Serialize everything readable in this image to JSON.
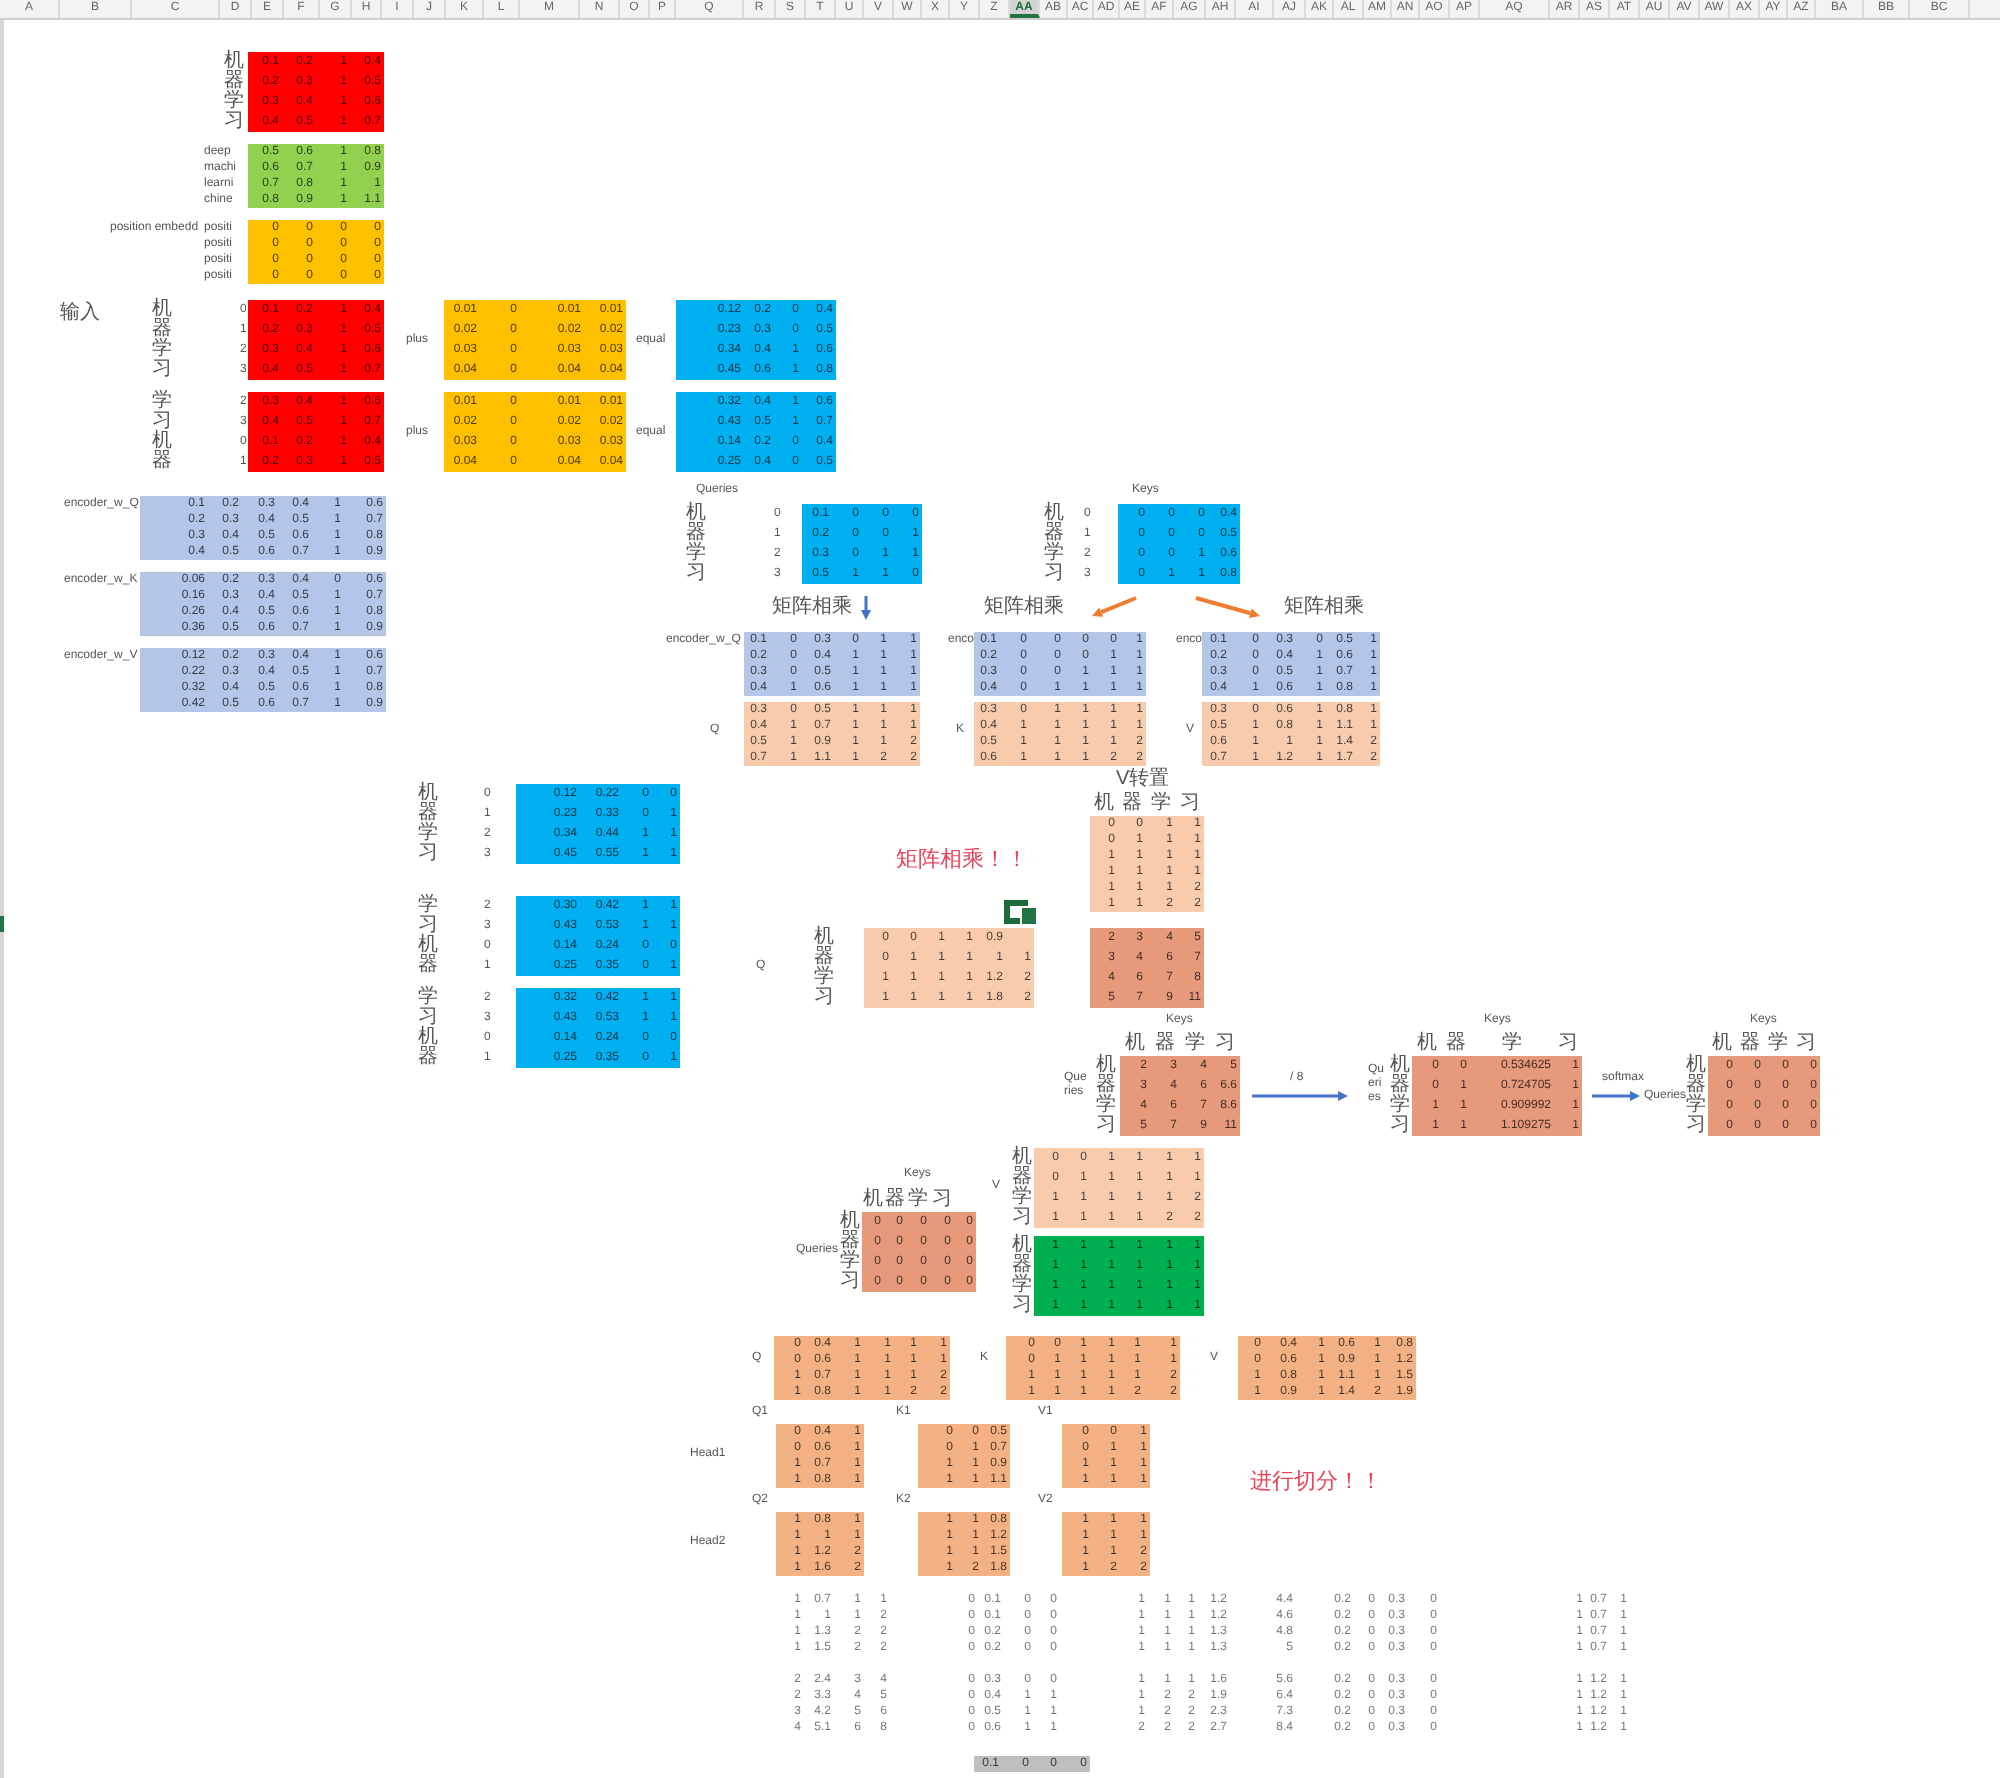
{
  "column_headers": [
    {
      "label": "A",
      "selected": false
    },
    {
      "label": "B",
      "selected": false
    },
    {
      "label": "C",
      "selected": false
    },
    {
      "label": "D",
      "selected": false
    },
    {
      "label": "E",
      "selected": false
    },
    {
      "label": "F",
      "selected": false
    },
    {
      "label": "G",
      "selected": false
    },
    {
      "label": "H",
      "selected": false
    },
    {
      "label": "I",
      "selected": false
    },
    {
      "label": "J",
      "selected": false
    },
    {
      "label": "K",
      "selected": false
    },
    {
      "label": "L",
      "selected": false
    },
    {
      "label": "M",
      "selected": false
    },
    {
      "label": "N",
      "selected": false
    },
    {
      "label": "O",
      "selected": false
    },
    {
      "label": "P",
      "selected": false
    },
    {
      "label": "Q",
      "selected": false
    },
    {
      "label": "R",
      "selected": false
    },
    {
      "label": "S",
      "selected": false
    },
    {
      "label": "T",
      "selected": false
    },
    {
      "label": "U",
      "selected": false
    },
    {
      "label": "V",
      "selected": false
    },
    {
      "label": "W",
      "selected": false
    },
    {
      "label": "X",
      "selected": false
    },
    {
      "label": "Y",
      "selected": false
    },
    {
      "label": "Z",
      "selected": false
    },
    {
      "label": "AA",
      "selected": true
    },
    {
      "label": "AB",
      "selected": false
    },
    {
      "label": "AC",
      "selected": false
    },
    {
      "label": "AD",
      "selected": false
    },
    {
      "label": "AE",
      "selected": false
    },
    {
      "label": "AF",
      "selected": false
    },
    {
      "label": "AG",
      "selected": false
    },
    {
      "label": "AH",
      "selected": false
    },
    {
      "label": "AI",
      "selected": false
    },
    {
      "label": "AJ",
      "selected": false
    },
    {
      "label": "AK",
      "selected": false
    },
    {
      "label": "AL",
      "selected": false
    },
    {
      "label": "AM",
      "selected": false
    },
    {
      "label": "AN",
      "selected": false
    },
    {
      "label": "AO",
      "selected": false
    },
    {
      "label": "AP",
      "selected": false
    },
    {
      "label": "AQ",
      "selected": false
    },
    {
      "label": "AR",
      "selected": false
    },
    {
      "label": "AS",
      "selected": false
    },
    {
      "label": "AT",
      "selected": false
    },
    {
      "label": "AU",
      "selected": false
    },
    {
      "label": "AV",
      "selected": false
    },
    {
      "label": "AW",
      "selected": false
    },
    {
      "label": "AX",
      "selected": false
    },
    {
      "label": "AY",
      "selected": false
    },
    {
      "label": "AZ",
      "selected": false
    },
    {
      "label": "BA",
      "selected": false
    },
    {
      "label": "BB",
      "selected": false
    },
    {
      "label": "BC",
      "selected": false
    }
  ],
  "matrices": [
    {
      "row_labels": [
        "机",
        "器",
        "学",
        "习"
      ],
      "color": "#ff0000",
      "rows": [
        [
          "0.1",
          "0.2",
          "1",
          "0.4"
        ],
        [
          "0.2",
          "0.3",
          "1",
          "0.5"
        ],
        [
          "0.3",
          "0.4",
          "1",
          "0.6"
        ],
        [
          "0.4",
          "0.5",
          "1",
          "0.7"
        ]
      ]
    },
    {
      "row_labels": [
        "deep",
        "machi",
        "learni",
        "chine"
      ],
      "color": "#92d050",
      "rows": [
        [
          "0.5",
          "0.6",
          "1",
          "0.8"
        ],
        [
          "0.6",
          "0.7",
          "1",
          "0.9"
        ],
        [
          "0.7",
          "0.8",
          "1",
          "1"
        ],
        [
          "0.8",
          "0.9",
          "1",
          "1.1"
        ]
      ]
    },
    {
      "row_labels": [
        "positi",
        "positi",
        "positi",
        "positi"
      ],
      "color": "#ffc000",
      "rows": [
        [
          "0",
          "0",
          "0",
          "0"
        ],
        [
          "0",
          "0",
          "0",
          "0"
        ],
        [
          "0",
          "0",
          "0",
          "0"
        ],
        [
          "0",
          "0",
          "0",
          "0"
        ]
      ]
    },
    {
      "row_labels": [
        "机",
        "器",
        "学",
        "习"
      ],
      "row_index": [
        "0",
        "1",
        "2",
        "3"
      ],
      "color": "#ff0000",
      "rows": [
        [
          "0.1",
          "0.2",
          "1",
          "0.4"
        ],
        [
          "0.2",
          "0.3",
          "1",
          "0.5"
        ],
        [
          "0.3",
          "0.4",
          "1",
          "0.6"
        ],
        [
          "0.4",
          "0.5",
          "1",
          "0.7"
        ]
      ]
    },
    {
      "color": "#ffc000",
      "rows": [
        [
          "0.01",
          "0",
          "0.01",
          "0.01"
        ],
        [
          "0.02",
          "0",
          "0.02",
          "0.02"
        ],
        [
          "0.03",
          "0",
          "0.03",
          "0.03"
        ],
        [
          "0.04",
          "0",
          "0.04",
          "0.04"
        ]
      ]
    },
    {
      "color": "#00b0f0",
      "rows": [
        [
          "0.12",
          "0.2",
          "0",
          "0.4"
        ],
        [
          "0.23",
          "0.3",
          "0",
          "0.5"
        ],
        [
          "0.34",
          "0.4",
          "1",
          "0.6"
        ],
        [
          "0.45",
          "0.6",
          "1",
          "0.8"
        ]
      ]
    },
    {
      "row_labels": [
        "学",
        "习",
        "机",
        "器"
      ],
      "row_index": [
        "2",
        "3",
        "0",
        "1"
      ],
      "color": "#ff0000",
      "rows": [
        [
          "0.3",
          "0.4",
          "1",
          "0.6"
        ],
        [
          "0.4",
          "0.5",
          "1",
          "0.7"
        ],
        [
          "0.1",
          "0.2",
          "1",
          "0.4"
        ],
        [
          "0.2",
          "0.3",
          "1",
          "0.5"
        ]
      ]
    },
    {
      "color": "#ffc000",
      "rows": [
        [
          "0.01",
          "0",
          "0.01",
          "0.01"
        ],
        [
          "0.02",
          "0",
          "0.02",
          "0.02"
        ],
        [
          "0.03",
          "0",
          "0.03",
          "0.03"
        ],
        [
          "0.04",
          "0",
          "0.04",
          "0.04"
        ]
      ]
    },
    {
      "color": "#00b0f0",
      "rows": [
        [
          "0.32",
          "0.4",
          "1",
          "0.6"
        ],
        [
          "0.43",
          "0.5",
          "1",
          "0.7"
        ],
        [
          "0.14",
          "0.2",
          "0",
          "0.4"
        ],
        [
          "0.25",
          "0.4",
          "0",
          "0.5"
        ]
      ]
    },
    {
      "color": "#b4c6e7",
      "rows": [
        [
          "0.1",
          "0.2",
          "0.3",
          "0.4",
          "1",
          "0.6"
        ],
        [
          "0.2",
          "0.3",
          "0.4",
          "0.5",
          "1",
          "0.7"
        ],
        [
          "0.3",
          "0.4",
          "0.5",
          "0.6",
          "1",
          "0.8"
        ],
        [
          "0.4",
          "0.5",
          "0.6",
          "0.7",
          "1",
          "0.9"
        ]
      ]
    },
    {
      "color": "#b4c6e7",
      "rows": [
        [
          "0.06",
          "0.2",
          "0.3",
          "0.4",
          "0",
          "0.6"
        ],
        [
          "0.16",
          "0.3",
          "0.4",
          "0.5",
          "1",
          "0.7"
        ],
        [
          "0.26",
          "0.4",
          "0.5",
          "0.6",
          "1",
          "0.8"
        ],
        [
          "0.36",
          "0.5",
          "0.6",
          "0.7",
          "1",
          "0.9"
        ]
      ]
    },
    {
      "color": "#b4c6e7",
      "rows": [
        [
          "0.12",
          "0.2",
          "0.3",
          "0.4",
          "1",
          "0.6"
        ],
        [
          "0.22",
          "0.3",
          "0.4",
          "0.5",
          "1",
          "0.7"
        ],
        [
          "0.32",
          "0.4",
          "0.5",
          "0.6",
          "1",
          "0.8"
        ],
        [
          "0.42",
          "0.5",
          "0.6",
          "0.7",
          "1",
          "0.9"
        ]
      ]
    },
    {
      "row_labels": [
        "机",
        "器",
        "学",
        "习"
      ],
      "row_index": [
        "0",
        "1",
        "2",
        "3"
      ],
      "color": "#00b0f0",
      "rows": [
        [
          "0.1",
          "0",
          "0",
          "0"
        ],
        [
          "0.2",
          "0",
          "0",
          "1"
        ],
        [
          "0.3",
          "0",
          "1",
          "1"
        ],
        [
          "0.5",
          "1",
          "1",
          "0"
        ]
      ]
    },
    {
      "row_labels": [
        "机",
        "器",
        "学",
        "习"
      ],
      "row_index": [
        "0",
        "1",
        "2",
        "3"
      ],
      "color": "#00b0f0",
      "rows": [
        [
          "0",
          "0",
          "0",
          "0.4"
        ],
        [
          "0",
          "0",
          "0",
          "0.5"
        ],
        [
          "0",
          "0",
          "1",
          "0.6"
        ],
        [
          "0",
          "1",
          "1",
          "0.8"
        ]
      ]
    },
    {
      "color": "#b4c6e7",
      "rows": [
        [
          "0.1",
          "0",
          "0.3",
          "0",
          "1",
          "1"
        ],
        [
          "0.2",
          "0",
          "0.4",
          "1",
          "1",
          "1"
        ],
        [
          "0.3",
          "0",
          "0.5",
          "1",
          "1",
          "1"
        ],
        [
          "0.4",
          "1",
          "0.6",
          "1",
          "1",
          "1"
        ]
      ]
    },
    {
      "color": "#b4c6e7",
      "rows": [
        [
          "0.1",
          "0",
          "0",
          "0",
          "0",
          "1"
        ],
        [
          "0.2",
          "0",
          "0",
          "0",
          "1",
          "1"
        ],
        [
          "0.3",
          "0",
          "0",
          "1",
          "1",
          "1"
        ],
        [
          "0.4",
          "0",
          "1",
          "1",
          "1",
          "1"
        ]
      ]
    },
    {
      "color": "#b4c6e7",
      "rows": [
        [
          "0.1",
          "0",
          "0.3",
          "0",
          "0.5",
          "1"
        ],
        [
          "0.2",
          "0",
          "0.4",
          "1",
          "0.6",
          "1"
        ],
        [
          "0.3",
          "0",
          "0.5",
          "1",
          "0.7",
          "1"
        ],
        [
          "0.4",
          "1",
          "0.6",
          "1",
          "0.8",
          "1"
        ]
      ]
    },
    {
      "color": "#f8cbad",
      "rows": [
        [
          "0.3",
          "0",
          "0.5",
          "1",
          "1",
          "1"
        ],
        [
          "0.4",
          "1",
          "0.7",
          "1",
          "1",
          "1"
        ],
        [
          "0.5",
          "1",
          "0.9",
          "1",
          "1",
          "2"
        ],
        [
          "0.7",
          "1",
          "1.1",
          "1",
          "2",
          "2"
        ]
      ]
    },
    {
      "color": "#f8cbad",
      "rows": [
        [
          "0.3",
          "0",
          "1",
          "1",
          "1",
          "1"
        ],
        [
          "0.4",
          "1",
          "1",
          "1",
          "1",
          "1"
        ],
        [
          "0.5",
          "1",
          "1",
          "1",
          "1",
          "2"
        ],
        [
          "0.6",
          "1",
          "1",
          "1",
          "2",
          "2"
        ]
      ]
    },
    {
      "color": "#f8cbad",
      "rows": [
        [
          "0.3",
          "0",
          "0.6",
          "1",
          "0.8",
          "1"
        ],
        [
          "0.5",
          "1",
          "0.8",
          "1",
          "1.1",
          "1"
        ],
        [
          "0.6",
          "1",
          "1",
          "1",
          "1.4",
          "2"
        ],
        [
          "0.7",
          "1",
          "1.2",
          "1",
          "1.7",
          "2"
        ]
      ]
    },
    {
      "row_labels": [
        "机",
        "器",
        "学",
        "习"
      ],
      "row_index": [
        "0",
        "1",
        "2",
        "3"
      ],
      "color": "#00b0f0",
      "rows": [
        [
          "0.12",
          "0.22",
          "0",
          "0"
        ],
        [
          "0.23",
          "0.33",
          "0",
          "1"
        ],
        [
          "0.34",
          "0.44",
          "1",
          "1"
        ],
        [
          "0.45",
          "0.55",
          "1",
          "1"
        ]
      ]
    },
    {
      "row_labels": [
        "学",
        "习",
        "机",
        "器"
      ],
      "row_index": [
        "2",
        "3",
        "0",
        "1"
      ],
      "color": "#00b0f0",
      "rows": [
        [
          "0.30",
          "0.42",
          "1",
          "1"
        ],
        [
          "0.43",
          "0.53",
          "1",
          "1"
        ],
        [
          "0.14",
          "0.24",
          "0",
          "0"
        ],
        [
          "0.25",
          "0.35",
          "0",
          "1"
        ]
      ]
    },
    {
      "row_labels": [
        "学",
        "习",
        "机",
        "器"
      ],
      "row_index": [
        "2",
        "3",
        "0",
        "1"
      ],
      "color": "#00b0f0",
      "rows": [
        [
          "0.32",
          "0.42",
          "1",
          "1"
        ],
        [
          "0.43",
          "0.53",
          "1",
          "1"
        ],
        [
          "0.14",
          "0.24",
          "0",
          "0"
        ],
        [
          "0.25",
          "0.35",
          "0",
          "1"
        ]
      ]
    },
    {
      "col_labels": [
        "机",
        "器",
        "学",
        "习"
      ],
      "color": "#f8cbad",
      "rows": [
        [
          "0",
          "0",
          "1",
          "1"
        ],
        [
          "0",
          "1",
          "1",
          "1"
        ],
        [
          "1",
          "1",
          "1",
          "1"
        ],
        [
          "1",
          "1",
          "1",
          "1"
        ],
        [
          "1",
          "1",
          "1",
          "2"
        ],
        [
          "1",
          "1",
          "2",
          "2"
        ]
      ]
    },
    {
      "row_labels": [
        "机",
        "器",
        "学",
        "习"
      ],
      "color": "#f8cbad",
      "rows": [
        [
          "0",
          "0",
          "1",
          "1",
          "0.9"
        ],
        [
          "0",
          "1",
          "1",
          "1",
          "1",
          "1"
        ],
        [
          "1",
          "1",
          "1",
          "1",
          "1.2",
          "2"
        ],
        [
          "1",
          "1",
          "1",
          "1",
          "1.8",
          "2"
        ]
      ]
    },
    {
      "color": "#e7997b",
      "rows": [
        [
          "2",
          "3",
          "4",
          "5"
        ],
        [
          "3",
          "4",
          "6",
          "7"
        ],
        [
          "4",
          "6",
          "7",
          "8"
        ],
        [
          "5",
          "7",
          "9",
          "11"
        ]
      ]
    },
    {
      "col_labels": [
        "机",
        "器",
        "学",
        "习"
      ],
      "row_labels": [
        "机",
        "器",
        "学",
        "习"
      ],
      "color": "#e7997b",
      "rows": [
        [
          "2",
          "3",
          "4",
          "5"
        ],
        [
          "3",
          "4",
          "6",
          "6.6"
        ],
        [
          "4",
          "6",
          "7",
          "8.6"
        ],
        [
          "5",
          "7",
          "9",
          "11"
        ]
      ]
    },
    {
      "col_labels": [
        "机",
        "器",
        "学",
        "习"
      ],
      "row_labels": [
        "机",
        "器",
        "学",
        "习"
      ],
      "color": "#e7997b",
      "rows": [
        [
          "0",
          "0",
          "0.534625",
          "1"
        ],
        [
          "0",
          "1",
          "0.724705",
          "1"
        ],
        [
          "1",
          "1",
          "0.909992",
          "1"
        ],
        [
          "1",
          "1",
          "1.109275",
          "1"
        ]
      ]
    },
    {
      "col_labels": [
        "机",
        "器",
        "学",
        "习"
      ],
      "row_labels": [
        "机",
        "器",
        "学",
        "习"
      ],
      "color": "#e7997b",
      "rows": [
        [
          "0",
          "0",
          "0",
          "0"
        ],
        [
          "0",
          "0",
          "0",
          "0"
        ],
        [
          "0",
          "0",
          "0",
          "0"
        ],
        [
          "0",
          "0",
          "0",
          "0"
        ]
      ]
    },
    {
      "row_labels": [
        "机",
        "器",
        "学",
        "习"
      ],
      "color": "#f8cbad",
      "rows": [
        [
          "0",
          "0",
          "1",
          "1",
          "1",
          "1"
        ],
        [
          "0",
          "1",
          "1",
          "1",
          "1",
          "1"
        ],
        [
          "1",
          "1",
          "1",
          "1",
          "1",
          "2"
        ],
        [
          "1",
          "1",
          "1",
          "1",
          "2",
          "2"
        ]
      ]
    },
    {
      "row_labels": [
        "机",
        "器",
        "学",
        "习"
      ],
      "color": "#00b050",
      "rows": [
        [
          "1",
          "1",
          "1",
          "1",
          "1",
          "1"
        ],
        [
          "1",
          "1",
          "1",
          "1",
          "1",
          "1"
        ],
        [
          "1",
          "1",
          "1",
          "1",
          "1",
          "1"
        ],
        [
          "1",
          "1",
          "1",
          "1",
          "1",
          "1"
        ]
      ]
    },
    {
      "col_labels": [
        "机",
        "器",
        "学",
        "习"
      ],
      "row_labels": [
        "机",
        "器",
        "学",
        "习"
      ],
      "color": "#e7997b",
      "rows": [
        [
          "0",
          "0",
          "0",
          "0",
          "0"
        ],
        [
          "0",
          "0",
          "0",
          "0",
          "0"
        ],
        [
          "0",
          "0",
          "0",
          "0",
          "0"
        ],
        [
          "0",
          "0",
          "0",
          "0",
          "0"
        ]
      ]
    },
    {
      "color": "#f4b183",
      "rows": [
        [
          "0",
          "0.4",
          "1",
          "1",
          "1",
          "1"
        ],
        [
          "0",
          "0.6",
          "1",
          "1",
          "1",
          "1"
        ],
        [
          "1",
          "0.7",
          "1",
          "1",
          "1",
          "2"
        ],
        [
          "1",
          "0.8",
          "1",
          "1",
          "2",
          "2"
        ]
      ]
    },
    {
      "color": "#f4b183",
      "rows": [
        [
          "0",
          "0",
          "1",
          "1",
          "1",
          "1"
        ],
        [
          "0",
          "1",
          "1",
          "1",
          "1",
          "1"
        ],
        [
          "1",
          "1",
          "1",
          "1",
          "1",
          "2"
        ],
        [
          "1",
          "1",
          "1",
          "1",
          "2",
          "2"
        ]
      ]
    },
    {
      "color": "#f4b183",
      "rows": [
        [
          "0",
          "0.4",
          "1",
          "0.6",
          "1",
          "0.8"
        ],
        [
          "0",
          "0.6",
          "1",
          "0.9",
          "1",
          "1.2"
        ],
        [
          "1",
          "0.8",
          "1",
          "1.1",
          "1",
          "1.5"
        ],
        [
          "1",
          "0.9",
          "1",
          "1.4",
          "2",
          "1.9"
        ]
      ]
    },
    {
      "color": "#f4b183",
      "rows": [
        [
          "0",
          "0.4",
          "1"
        ],
        [
          "0",
          "0.6",
          "1"
        ],
        [
          "1",
          "0.7",
          "1"
        ],
        [
          "1",
          "0.8",
          "1"
        ]
      ]
    },
    {
      "color": "#f4b183",
      "rows": [
        [
          "0",
          "0",
          "0.5"
        ],
        [
          "0",
          "1",
          "0.7"
        ],
        [
          "1",
          "1",
          "0.9"
        ],
        [
          "1",
          "1",
          "1.1"
        ]
      ]
    },
    {
      "color": "#f4b183",
      "rows": [
        [
          "0",
          "0",
          "1"
        ],
        [
          "0",
          "1",
          "1"
        ],
        [
          "1",
          "1",
          "1"
        ],
        [
          "1",
          "1",
          "1"
        ]
      ]
    },
    {
      "color": "#f4b183",
      "rows": [
        [
          "1",
          "0.8",
          "1"
        ],
        [
          "1",
          "1",
          "1"
        ],
        [
          "1",
          "1.2",
          "2"
        ],
        [
          "1",
          "1.6",
          "2"
        ]
      ]
    },
    {
      "color": "#f4b183",
      "rows": [
        [
          "1",
          "1",
          "0.8"
        ],
        [
          "1",
          "1",
          "1.2"
        ],
        [
          "1",
          "1",
          "1.5"
        ],
        [
          "1",
          "2",
          "1.8"
        ]
      ]
    },
    {
      "color": "#f4b183",
      "rows": [
        [
          "1",
          "1",
          "1"
        ],
        [
          "1",
          "1",
          "1"
        ],
        [
          "1",
          "1",
          "2"
        ],
        [
          "1",
          "2",
          "2"
        ]
      ]
    },
    {
      "rows": [
        [
          "1",
          "0.7",
          "1",
          "1"
        ],
        [
          "1",
          "1",
          "1",
          "2"
        ],
        [
          "1",
          "1.3",
          "2",
          "2"
        ],
        [
          "1",
          "1.5",
          "2",
          "2"
        ]
      ]
    },
    {
      "rows": [
        [
          "0",
          "0.1",
          "0",
          "0"
        ],
        [
          "0",
          "0.1",
          "0",
          "0"
        ],
        [
          "0",
          "0.2",
          "0",
          "0"
        ],
        [
          "0",
          "0.2",
          "0",
          "0"
        ]
      ]
    },
    {
      "rows": [
        [
          "1",
          "1",
          "1",
          "1.2"
        ],
        [
          "1",
          "1",
          "1",
          "1.2"
        ],
        [
          "1",
          "1",
          "1",
          "1.3"
        ],
        [
          "1",
          "1",
          "1",
          "1.3"
        ]
      ]
    },
    {
      "rows": [
        [
          "4.4"
        ],
        [
          "4.6"
        ],
        [
          "4.8"
        ],
        [
          "5"
        ]
      ]
    },
    {
      "rows": [
        [
          "0.2",
          "0",
          "0.3",
          "0"
        ],
        [
          "0.2",
          "0",
          "0.3",
          "0"
        ],
        [
          "0.2",
          "0",
          "0.3",
          "0"
        ],
        [
          "0.2",
          "0",
          "0.3",
          "0"
        ]
      ]
    },
    {
      "rows": [
        [
          "1",
          "0.7",
          "1"
        ],
        [
          "1",
          "0.7",
          "1"
        ],
        [
          "1",
          "0.7",
          "1"
        ],
        [
          "1",
          "0.7",
          "1"
        ]
      ]
    },
    {
      "rows": [
        [
          "2",
          "2.4",
          "3",
          "4"
        ],
        [
          "2",
          "3.3",
          "4",
          "5"
        ],
        [
          "3",
          "4.2",
          "5",
          "6"
        ],
        [
          "4",
          "5.1",
          "6",
          "8"
        ]
      ]
    },
    {
      "rows": [
        [
          "0",
          "0.3",
          "0",
          "0"
        ],
        [
          "0",
          "0.4",
          "1",
          "1"
        ],
        [
          "0",
          "0.5",
          "1",
          "1"
        ],
        [
          "0",
          "0.6",
          "1",
          "1"
        ]
      ]
    },
    {
      "rows": [
        [
          "1",
          "1",
          "1",
          "1.6"
        ],
        [
          "1",
          "2",
          "2",
          "1.9"
        ],
        [
          "1",
          "2",
          "2",
          "2.3"
        ],
        [
          "2",
          "2",
          "2",
          "2.7"
        ]
      ]
    },
    {
      "rows": [
        [
          "5.6"
        ],
        [
          "6.4"
        ],
        [
          "7.3"
        ],
        [
          "8.4"
        ]
      ]
    },
    {
      "rows": [
        [
          "0.2",
          "0",
          "0.3",
          "0"
        ],
        [
          "0.2",
          "0",
          "0.3",
          "0"
        ],
        [
          "0.2",
          "0",
          "0.3",
          "0"
        ],
        [
          "0.2",
          "0",
          "0.3",
          "0"
        ]
      ]
    },
    {
      "rows": [
        [
          "1",
          "1.2",
          "1"
        ],
        [
          "1",
          "1.2",
          "1"
        ],
        [
          "1",
          "1.2",
          "1"
        ],
        [
          "1",
          "1.2",
          "1"
        ]
      ]
    },
    {
      "color": "#bfbfbf",
      "rows": [
        [
          "0.1",
          "0",
          "0",
          "0"
        ]
      ]
    }
  ],
  "notes": [
    {
      "text": "position embedd",
      "kind": "label"
    },
    {
      "text": "输入",
      "kind": "label"
    },
    {
      "text": "plus",
      "kind": "label"
    },
    {
      "text": "equal",
      "kind": "label"
    },
    {
      "text": "plus",
      "kind": "label"
    },
    {
      "text": "equal",
      "kind": "label"
    },
    {
      "text": "encoder_w_Q",
      "kind": "label"
    },
    {
      "text": "encoder_w_K",
      "kind": "label"
    },
    {
      "text": "encoder_w_V",
      "kind": "label"
    },
    {
      "text": "Queries",
      "kind": "label"
    },
    {
      "text": "Keys",
      "kind": "label"
    },
    {
      "text": "矩阵相乘",
      "kind": "label"
    },
    {
      "text": "矩阵相乘",
      "kind": "label"
    },
    {
      "text": "矩阵相乘",
      "kind": "label"
    },
    {
      "text": "encoder_w_Q",
      "kind": "label"
    },
    {
      "text": "enco",
      "kind": "label"
    },
    {
      "text": "enco",
      "kind": "label"
    },
    {
      "text": "Q",
      "kind": "label"
    },
    {
      "text": "K",
      "kind": "label"
    },
    {
      "text": "V",
      "kind": "label"
    },
    {
      "text": "V转置",
      "kind": "label"
    },
    {
      "text": "矩阵相乘！！",
      "kind": "alert"
    },
    {
      "text": "Q",
      "kind": "label"
    },
    {
      "text": "Keys",
      "kind": "label"
    },
    {
      "text": "Queries",
      "kind": "label"
    },
    {
      "text": "/ 8",
      "kind": "label"
    },
    {
      "text": "Keys",
      "kind": "label"
    },
    {
      "text": "Queries",
      "kind": "label"
    },
    {
      "text": "softmax",
      "kind": "label"
    },
    {
      "text": "Queries",
      "kind": "label"
    },
    {
      "text": "Keys",
      "kind": "label"
    },
    {
      "text": "V",
      "kind": "label"
    },
    {
      "text": "Keys",
      "kind": "label"
    },
    {
      "text": "Queries",
      "kind": "label"
    },
    {
      "text": "Q",
      "kind": "label"
    },
    {
      "text": "K",
      "kind": "label"
    },
    {
      "text": "V",
      "kind": "label"
    },
    {
      "text": "Q1",
      "kind": "label"
    },
    {
      "text": "Head1",
      "kind": "label"
    },
    {
      "text": "K1",
      "kind": "label"
    },
    {
      "text": "V1",
      "kind": "label"
    },
    {
      "text": "Q2",
      "kind": "label"
    },
    {
      "text": "Head2",
      "kind": "label"
    },
    {
      "text": "K2",
      "kind": "label"
    },
    {
      "text": "V2",
      "kind": "label"
    },
    {
      "text": "进行切分！！",
      "kind": "alert"
    }
  ]
}
